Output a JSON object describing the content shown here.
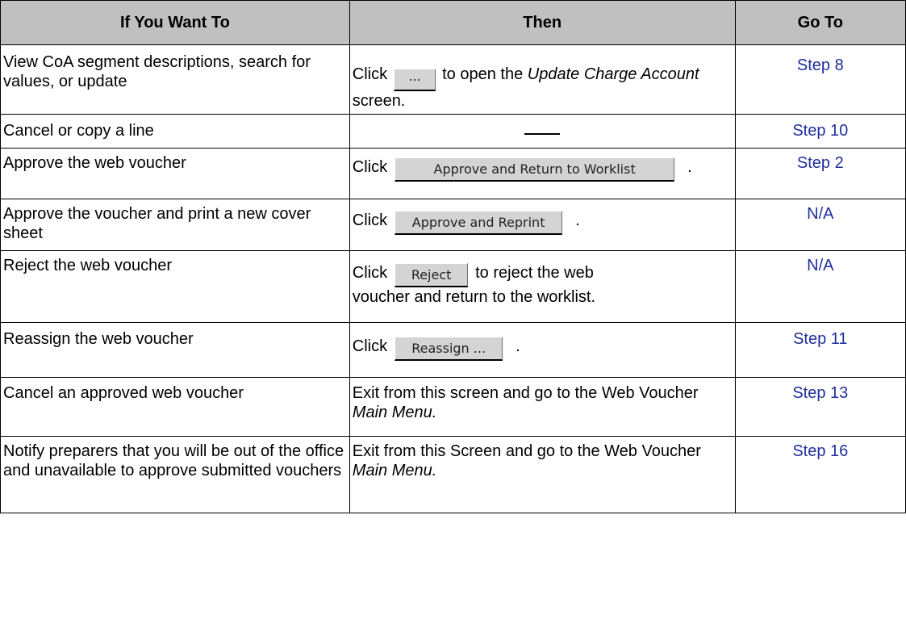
{
  "headers": {
    "want": "If You Want To",
    "then": "Then",
    "goto": "Go To"
  },
  "click_word": "Click",
  "period": ".",
  "dash": "___",
  "rows": [
    {
      "want": "View CoA segment descriptions, search for values, or update",
      "button": "...",
      "then_pre": "to open the",
      "then_em": "Update Charge Account",
      "then_post": "screen.",
      "goto": "Step 8"
    },
    {
      "want": "Cancel or copy a line",
      "goto": "Step 10"
    },
    {
      "want": "Approve the web voucher",
      "button": "Approve and Return to Worklist",
      "goto": "Step 2"
    },
    {
      "want": "Approve the voucher and print a new cover sheet",
      "button": "Approve and Reprint",
      "goto": "N/A"
    },
    {
      "want": "Reject the web voucher",
      "button": "Reject",
      "then_line1": "to reject the web",
      "then_line2": "voucher and return to the worklist.",
      "goto": "N/A"
    },
    {
      "want": "Reassign the web voucher",
      "button": "Reassign ...",
      "goto": "Step 11"
    },
    {
      "want": "Cancel an approved web voucher",
      "then_text": "Exit from this screen and go to the Web Voucher",
      "then_em": "Main Menu.",
      "goto": "Step 13"
    },
    {
      "want": "Notify preparers that you will be out of the office and unavailable to approve submitted vouchers",
      "then_text": "Exit from this Screen and go to the Web Voucher",
      "then_em": "Main Menu.",
      "goto": "Step 16"
    }
  ]
}
